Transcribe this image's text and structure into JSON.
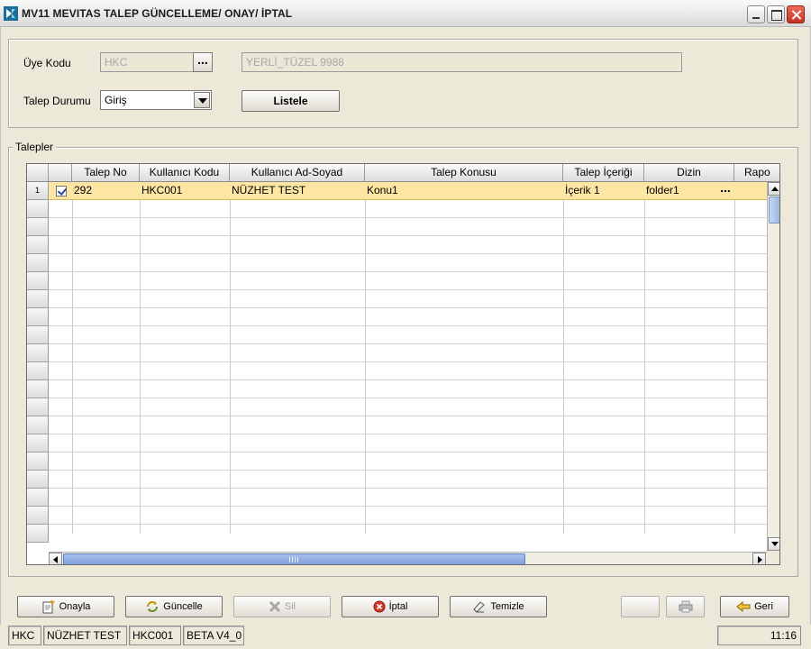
{
  "window": {
    "title": "MV11 MEVITAS TALEP GÜNCELLEME/ ONAY/ İPTAL"
  },
  "form": {
    "uye_kodu_label": "Üye Kodu",
    "uye_kodu_value": "HKC",
    "uye_kodu_lookup": "...",
    "uye_adi_value": "YERLİ_TÜZEL 9988",
    "talep_durumu_label": "Talep Durumu",
    "talep_durumu_value": "Giriş",
    "listele_label": "Listele"
  },
  "group": {
    "legend": "Talepler"
  },
  "table": {
    "columns": [
      "Talep No",
      "Kullanıcı Kodu",
      "Kullanıcı Ad-Soyad",
      "Talep Konusu",
      "Talep İçeriği",
      "Dizin",
      "Rapo"
    ],
    "rows": [
      {
        "index": "1",
        "checked": true,
        "talep_no": "292",
        "kullanici_kodu": "HKC001",
        "ad_soyad": "NÜZHET TEST",
        "talep_konusu": "Konu1",
        "talep_icerigi": "İçerik 1",
        "dizin": "folder1",
        "dizin_lookup": "..."
      }
    ],
    "selected_row_color": "#fde6a3"
  },
  "buttons": {
    "onayla": "Onayla",
    "guncelle": "Güncelle",
    "sil": "Sil",
    "iptal": "İptal",
    "temizle": "Temizle",
    "geri": "Geri"
  },
  "icons": {
    "onayla": "approve-icon",
    "guncelle": "refresh-icon",
    "sil": "delete-icon",
    "iptal": "cancel-icon",
    "temizle": "eraser-icon",
    "print": "printer-icon",
    "geri": "back-arrow-icon"
  },
  "statusbar": {
    "member": "HKC",
    "user_name": "NÜZHET TEST",
    "user_code": "HKC001",
    "version": "BETA V4_0",
    "time": "11:16"
  }
}
